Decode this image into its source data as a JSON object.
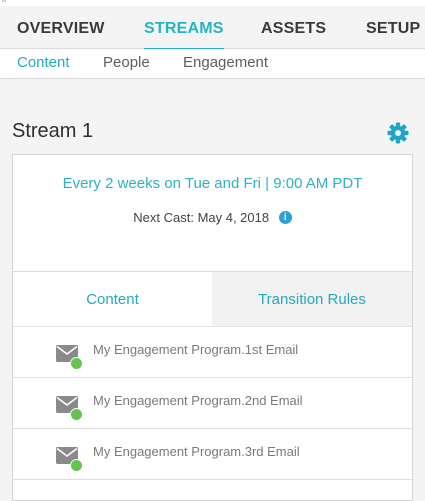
{
  "colors": {
    "accent": "#26b3c6",
    "link_blue": "#2b9fd6",
    "status_green": "#63c450",
    "text_dark": "#2f2f2f"
  },
  "main_tabs": [
    {
      "label": "OVERVIEW",
      "active": false
    },
    {
      "label": "STREAMS",
      "active": true
    },
    {
      "label": "ASSETS",
      "active": false
    },
    {
      "label": "SETUP",
      "active": false
    }
  ],
  "sub_tabs": [
    {
      "label": "Content",
      "active": true
    },
    {
      "label": "People",
      "active": false
    },
    {
      "label": "Engagement",
      "active": false
    }
  ],
  "stream": {
    "title": "Stream 1",
    "settings_icon": "gear-icon",
    "schedule": "Every 2 weeks on Tue and Fri | 9:00 AM PDT",
    "next_cast_label": "Next Cast:",
    "next_cast_date": "May 4, 2018",
    "info_icon": "info-icon"
  },
  "card_tabs": [
    {
      "label": "Content",
      "active": true
    },
    {
      "label": "Transition Rules",
      "active": false
    }
  ],
  "emails": [
    {
      "label": "My Engagement Program.1st Email",
      "icon": "email-icon",
      "status": "approved"
    },
    {
      "label": "My Engagement Program.2nd Email",
      "icon": "email-icon",
      "status": "approved"
    },
    {
      "label": "My Engagement Program.3rd Email",
      "icon": "email-icon",
      "status": "approved"
    }
  ]
}
